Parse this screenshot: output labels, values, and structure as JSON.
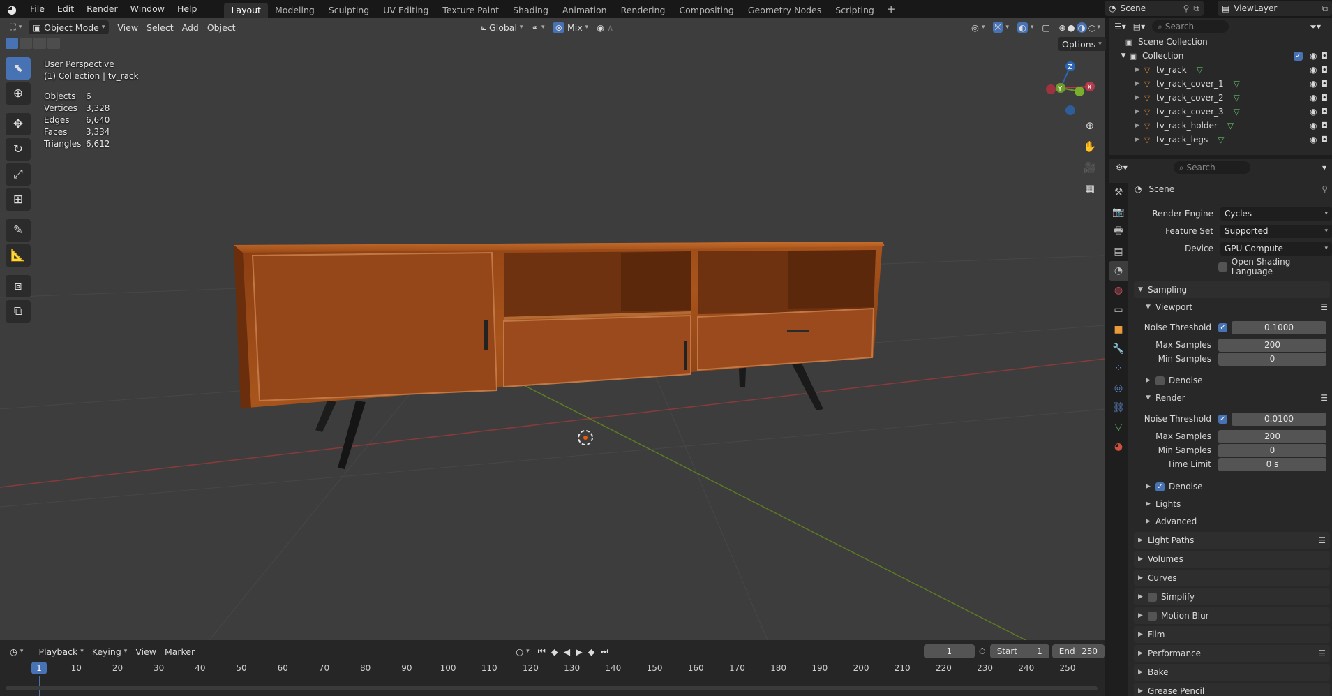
{
  "topbar": {
    "menus": [
      "File",
      "Edit",
      "Render",
      "Window",
      "Help"
    ],
    "workspaces": [
      "Layout",
      "Modeling",
      "Sculpting",
      "UV Editing",
      "Texture Paint",
      "Shading",
      "Animation",
      "Rendering",
      "Compositing",
      "Geometry Nodes",
      "Scripting"
    ],
    "active_workspace": "Layout",
    "scene": "Scene",
    "view_layer": "ViewLayer"
  },
  "viewport": {
    "mode": "Object Mode",
    "menus": [
      "View",
      "Select",
      "Add",
      "Object"
    ],
    "transform_orientation": "Global",
    "snap_mode": "Mix",
    "options_label": "Options",
    "perspective": "User Perspective",
    "collection_info": "(1) Collection | tv_rack",
    "stats": [
      {
        "label": "Objects",
        "value": "6"
      },
      {
        "label": "Vertices",
        "value": "3,328"
      },
      {
        "label": "Edges",
        "value": "6,640"
      },
      {
        "label": "Faces",
        "value": "3,334"
      },
      {
        "label": "Triangles",
        "value": "6,612"
      }
    ],
    "gizmo": {
      "x": "X",
      "y": "Y",
      "z": "Z"
    }
  },
  "timeline": {
    "menus": [
      "Playback",
      "Keying",
      "View",
      "Marker"
    ],
    "current_frame": "1",
    "start_label": "Start",
    "start": "1",
    "end_label": "End",
    "end": "250",
    "ruler": [
      "1",
      "10",
      "20",
      "30",
      "40",
      "50",
      "60",
      "70",
      "80",
      "90",
      "100",
      "110",
      "120",
      "130",
      "140",
      "150",
      "160",
      "170",
      "180",
      "190",
      "200",
      "210",
      "220",
      "230",
      "240",
      "250"
    ]
  },
  "outliner": {
    "search_placeholder": "Search",
    "scene_collection": "Scene Collection",
    "collection": "Collection",
    "objects": [
      "tv_rack",
      "tv_rack_cover_1",
      "tv_rack_cover_2",
      "tv_rack_cover_3",
      "tv_rack_holder",
      "tv_rack_legs"
    ]
  },
  "properties": {
    "search_placeholder": "Search",
    "context": "Scene",
    "render_engine_label": "Render Engine",
    "render_engine": "Cycles",
    "feature_set_label": "Feature Set",
    "feature_set": "Supported",
    "device_label": "Device",
    "device": "GPU Compute",
    "osl_label": "Open Shading Language",
    "sampling": "Sampling",
    "viewport": "Viewport",
    "noise_threshold_label": "Noise Threshold",
    "viewport_noise": "0.1000",
    "max_samples_label": "Max Samples",
    "viewport_max": "200",
    "min_samples_label": "Min Samples",
    "viewport_min": "0",
    "denoise_label": "Denoise",
    "render": "Render",
    "render_noise": "0.0100",
    "render_max": "200",
    "render_min": "0",
    "time_limit_label": "Time Limit",
    "time_limit": "0 s",
    "lights": "Lights",
    "advanced": "Advanced",
    "panels": [
      "Light Paths",
      "Volumes",
      "Curves",
      "Simplify",
      "Motion Blur",
      "Film",
      "Performance",
      "Bake",
      "Grease Pencil"
    ]
  }
}
